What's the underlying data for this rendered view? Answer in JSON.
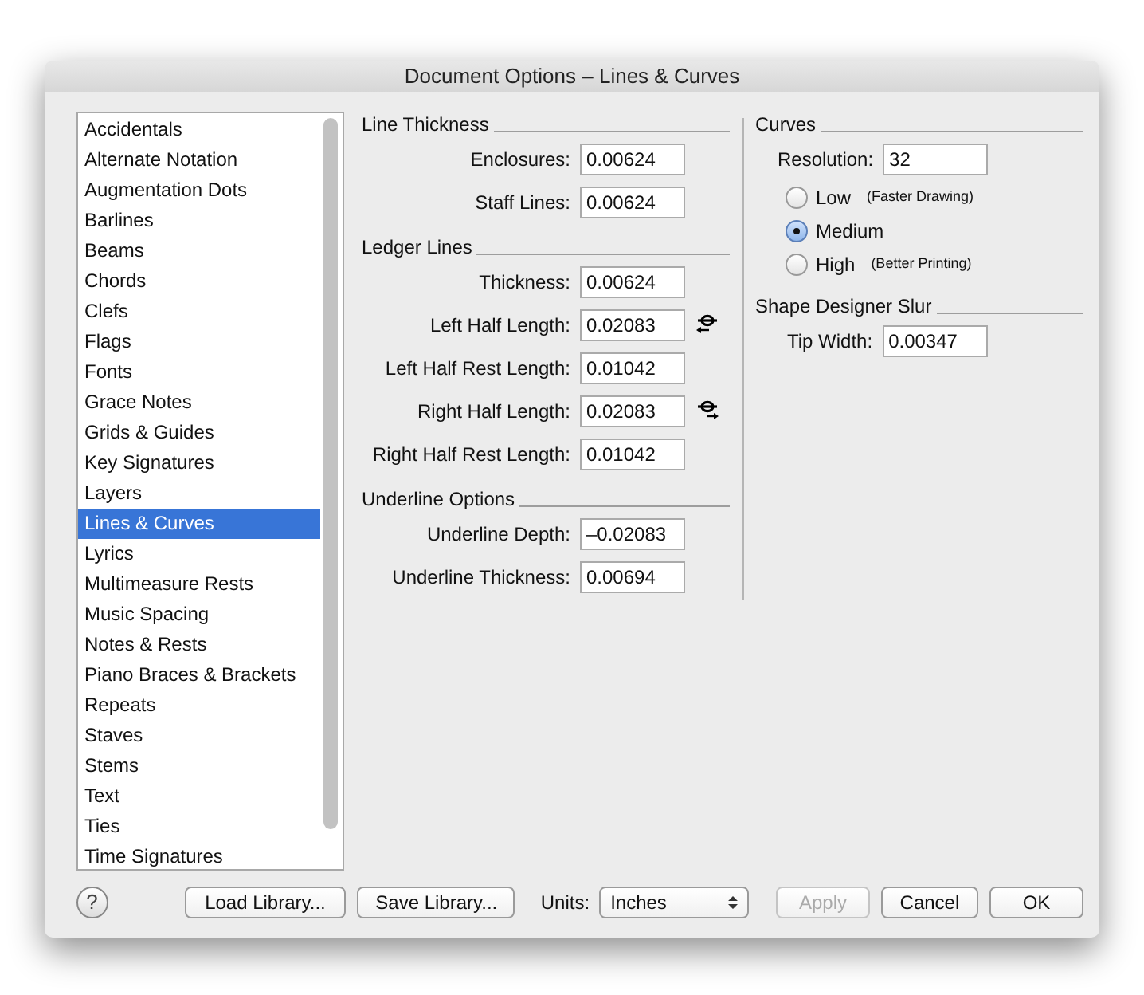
{
  "window": {
    "title": "Document Options – Lines & Curves"
  },
  "sidebar": {
    "items": [
      {
        "label": "Accidentals",
        "selected": false
      },
      {
        "label": "Alternate Notation",
        "selected": false
      },
      {
        "label": "Augmentation Dots",
        "selected": false
      },
      {
        "label": "Barlines",
        "selected": false
      },
      {
        "label": "Beams",
        "selected": false
      },
      {
        "label": "Chords",
        "selected": false
      },
      {
        "label": "Clefs",
        "selected": false
      },
      {
        "label": "Flags",
        "selected": false
      },
      {
        "label": "Fonts",
        "selected": false
      },
      {
        "label": "Grace Notes",
        "selected": false
      },
      {
        "label": "Grids & Guides",
        "selected": false
      },
      {
        "label": "Key Signatures",
        "selected": false
      },
      {
        "label": "Layers",
        "selected": false
      },
      {
        "label": "Lines & Curves",
        "selected": true
      },
      {
        "label": "Lyrics",
        "selected": false
      },
      {
        "label": "Multimeasure Rests",
        "selected": false
      },
      {
        "label": "Music Spacing",
        "selected": false
      },
      {
        "label": "Notes & Rests",
        "selected": false
      },
      {
        "label": "Piano Braces & Brackets",
        "selected": false
      },
      {
        "label": "Repeats",
        "selected": false
      },
      {
        "label": "Staves",
        "selected": false
      },
      {
        "label": "Stems",
        "selected": false
      },
      {
        "label": "Text",
        "selected": false
      },
      {
        "label": "Ties",
        "selected": false
      },
      {
        "label": "Time Signatures",
        "selected": false
      }
    ]
  },
  "left_groups": [
    {
      "title": "Line Thickness",
      "fields": [
        {
          "label": "Enclosures:",
          "value": "0.00624"
        },
        {
          "label": "Staff Lines:",
          "value": "0.00624"
        }
      ]
    },
    {
      "title": "Ledger Lines",
      "fields": [
        {
          "label": "Thickness:",
          "value": "0.00624"
        },
        {
          "label": "Left Half Length:",
          "value": "0.02083",
          "kind": "left"
        },
        {
          "label": "Left Half Rest Length:",
          "value": "0.01042"
        },
        {
          "label": "Right Half Length:",
          "value": "0.02083",
          "kind": "right"
        },
        {
          "label": "Right Half Rest Length:",
          "value": "0.01042"
        }
      ]
    },
    {
      "title": "Underline Options",
      "fields": [
        {
          "label": "Underline Depth:",
          "value": "–0.02083"
        },
        {
          "label": "Underline Thickness:",
          "value": "0.00694"
        }
      ]
    }
  ],
  "curves": {
    "title": "Curves",
    "resolution_label": "Resolution:",
    "resolution": "32",
    "options": [
      {
        "label": "Low",
        "note": "(Faster Drawing)",
        "selected": false
      },
      {
        "label": "Medium",
        "selected": true
      },
      {
        "label": "High",
        "note": "(Better Printing)",
        "selected": false
      }
    ]
  },
  "slur": {
    "title": "Shape Designer Slur",
    "label": "Tip Width:",
    "value": "0.00347"
  },
  "footer": {
    "help": "?",
    "load": "Load Library...",
    "save": "Save Library...",
    "units_label": "Units:",
    "units": "Inches",
    "buttons": [
      {
        "label": "Apply",
        "disabled": true
      },
      {
        "label": "Cancel",
        "disabled": false
      },
      {
        "label": "OK",
        "disabled": false
      }
    ]
  }
}
